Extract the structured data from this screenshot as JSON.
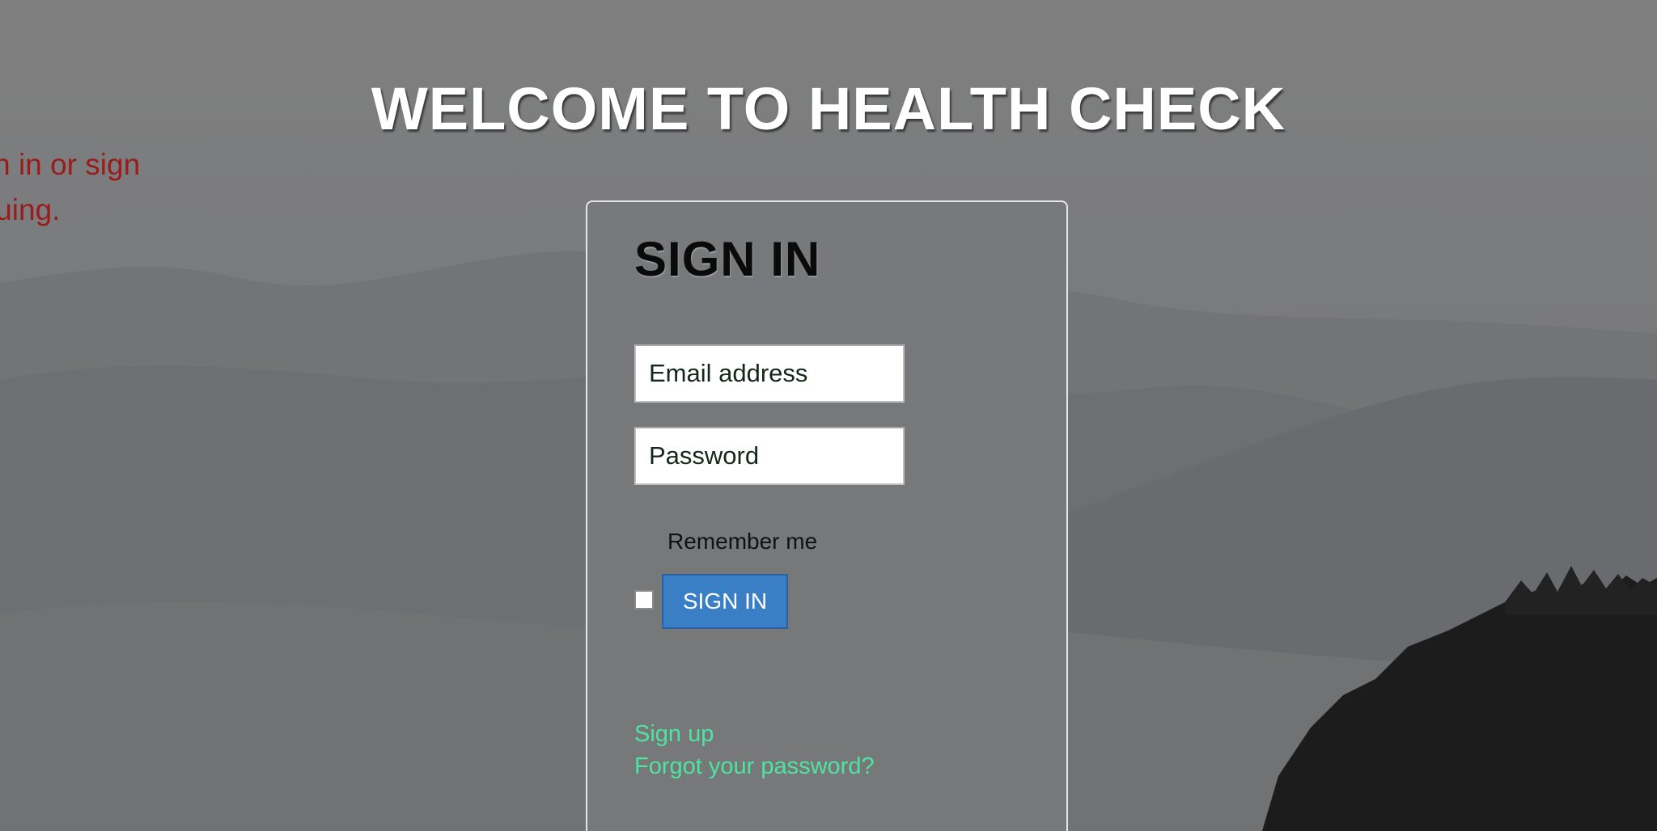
{
  "page": {
    "title": "WELCOME TO HEALTH CHECK"
  },
  "alert": {
    "message": "e sign in or sign ontinuing."
  },
  "signin_form": {
    "heading": "SIGN IN",
    "email": {
      "placeholder": "Email address",
      "value": ""
    },
    "password": {
      "placeholder": "Password",
      "value": ""
    },
    "remember_label": "Remember me",
    "remember_checked": false,
    "submit_label": "SIGN IN",
    "links": {
      "sign_up": "Sign up",
      "forgot_password": "Forgot your password?"
    }
  },
  "colors": {
    "alert_text": "#9a1b1b",
    "button": "#3a7fc6",
    "link": "#4fe3a3",
    "title_text": "#ffffff"
  }
}
